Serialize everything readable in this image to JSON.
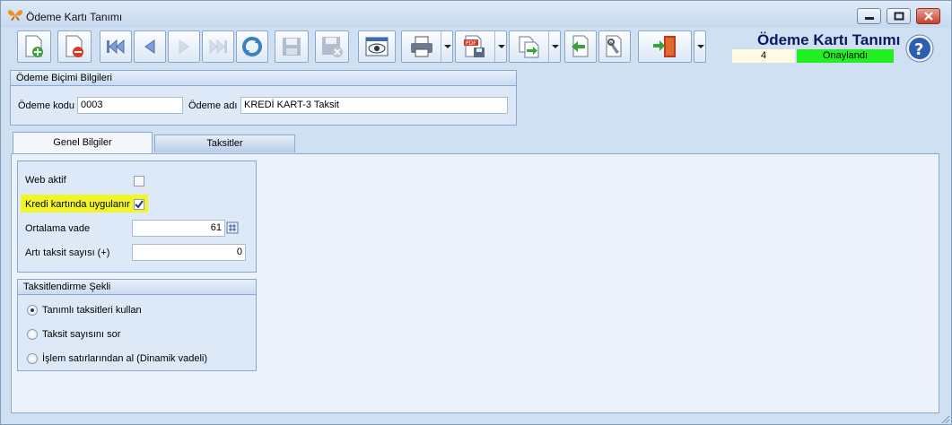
{
  "window": {
    "title": "Ödeme Kartı Tanımı"
  },
  "header": {
    "form_title": "Ödeme Kartı Tanımı",
    "record_no": "4",
    "status": "Onaylandı",
    "status_color": "#20f020"
  },
  "toolbar": {
    "icons": [
      "new-icon",
      "delete-icon",
      "first-icon",
      "previous-icon",
      "next-icon",
      "last-icon",
      "refresh-icon",
      "save-icon",
      "save-cancel-icon",
      "preview-icon",
      "print-icon",
      "pdf-export-icon",
      "import-icon",
      "back-icon",
      "tools-icon",
      "exit-door-icon",
      "help-icon"
    ]
  },
  "payment_info": {
    "group_title": "Ödeme Biçimi Bilgileri",
    "code_label": "Ödeme kodu",
    "code_value": "0003",
    "name_label": "Ödeme adı",
    "name_value": "KREDİ KART-3 Taksit"
  },
  "tabs": [
    {
      "label": "Genel Bilgiler",
      "active": true
    },
    {
      "label": "Taksitler",
      "active": false
    }
  ],
  "general": {
    "web_active_label": "Web aktif",
    "web_active_checked": false,
    "credit_card_label": "Kredi kartında uygulanır",
    "credit_card_checked": true,
    "avg_term_label": "Ortalama vade",
    "avg_term_value": "61",
    "extra_installments_label": "Artı taksit sayısı (+)",
    "extra_installments_value": "0"
  },
  "installment_mode": {
    "group_title": "Taksitlendirme Şekli",
    "options": [
      {
        "label": "Tanımlı taksitleri kullan",
        "selected": true
      },
      {
        "label": "Taksit sayısını sor",
        "selected": false
      },
      {
        "label": "İşlem satırlarından al (Dinamik vadeli)",
        "selected": false
      }
    ]
  }
}
